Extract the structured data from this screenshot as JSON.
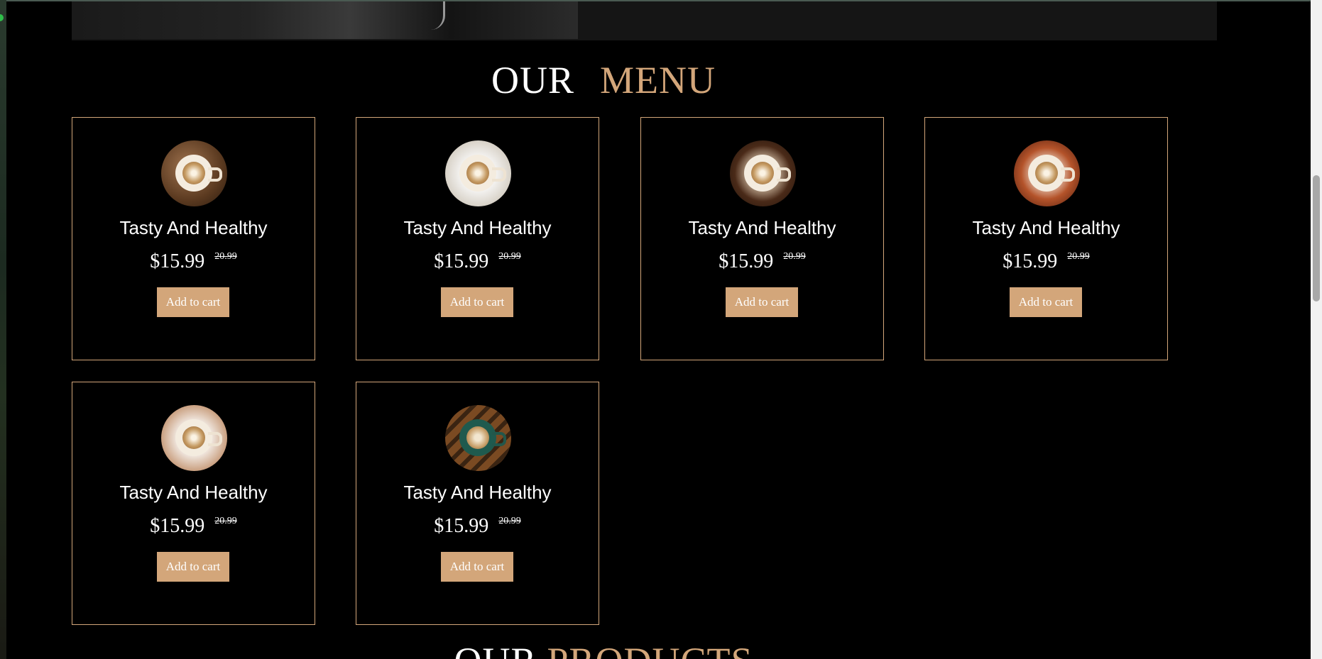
{
  "menu_section": {
    "title_word1": "OUR",
    "title_word2": "MENU"
  },
  "menu_items": [
    {
      "name": "Tasty And Healthy",
      "price": "$15.99",
      "old_price": "20.99",
      "button": "Add to cart",
      "image_icon": "latte-cup-icon"
    },
    {
      "name": "Tasty And Healthy",
      "price": "$15.99",
      "old_price": "20.99",
      "button": "Add to cart",
      "image_icon": "latte-cup-icon"
    },
    {
      "name": "Tasty And Healthy",
      "price": "$15.99",
      "old_price": "20.99",
      "button": "Add to cart",
      "image_icon": "latte-cup-icon"
    },
    {
      "name": "Tasty And Healthy",
      "price": "$15.99",
      "old_price": "20.99",
      "button": "Add to cart",
      "image_icon": "cappuccino-cup-icon"
    },
    {
      "name": "Tasty And Healthy",
      "price": "$15.99",
      "old_price": "20.99",
      "button": "Add to cart",
      "image_icon": "latte-cup-icon"
    },
    {
      "name": "Tasty And Healthy",
      "price": "$15.99",
      "old_price": "20.99",
      "button": "Add to cart",
      "image_icon": "cappuccino-cup-icon"
    }
  ],
  "products_section": {
    "title_word1": "OUR",
    "title_word2": "PRODUCTS"
  },
  "colors": {
    "background": "#000000",
    "accent": "#d3a67a",
    "text": "#ffffff"
  }
}
